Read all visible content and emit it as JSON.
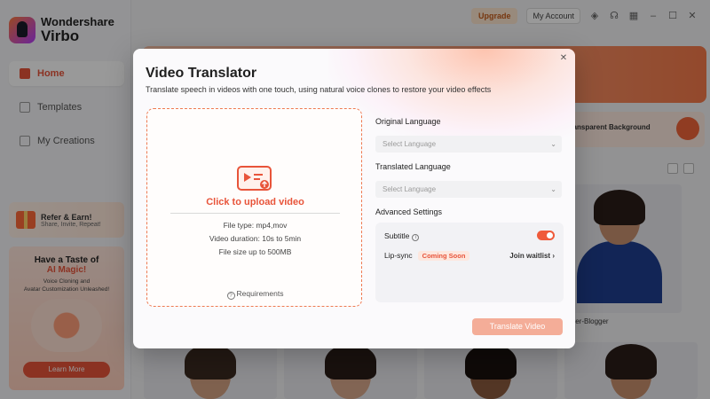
{
  "app": {
    "brand_line1": "Wondershare",
    "brand_line2": "Virbo"
  },
  "sidebar": {
    "items": [
      {
        "label": "Home",
        "active": true
      },
      {
        "label": "Templates",
        "active": false
      },
      {
        "label": "My Creations",
        "active": false
      }
    ],
    "refer": {
      "title": "Refer & Earn!",
      "subtitle": "Share, Invite, Repeat!"
    },
    "promo": {
      "title": "Have a Taste of",
      "accent": "AI Magic!",
      "subtitle_1": "Voice Cloning and",
      "subtitle_2": "Avatar Customization Unleashed!",
      "button": "Learn More"
    }
  },
  "topbar": {
    "upgrade": "Upgrade",
    "account": "My Account"
  },
  "background": {
    "feature_card": "Transparent Background",
    "avatar_label": "Super-Blogger"
  },
  "modal": {
    "title": "Video Translator",
    "subtitle": "Translate speech in videos with one touch, using natural voice clones to restore your video effects",
    "upload": {
      "link": "Click to upload video",
      "file_type": "File type: mp4,mov",
      "duration": "Video duration: 10s to 5min",
      "size": "File size up to  500MB",
      "requirements": "Requirements"
    },
    "original_language": {
      "label": "Original Language",
      "placeholder": "Select Language"
    },
    "translated_language": {
      "label": "Translated Language",
      "placeholder": "Select Language"
    },
    "advanced": {
      "label": "Advanced Settings",
      "subtitle_label": "Subtitle",
      "subtitle_enabled": true,
      "lipsync_label": "Lip-sync",
      "coming_soon": "Coming Soon",
      "join_waitlist": "Join waitlist"
    },
    "translate_button": "Translate Video",
    "colors": {
      "accent": "#e8543a",
      "button_disabled": "#f4ad98",
      "toggle_on": "#ef5a3a"
    }
  }
}
